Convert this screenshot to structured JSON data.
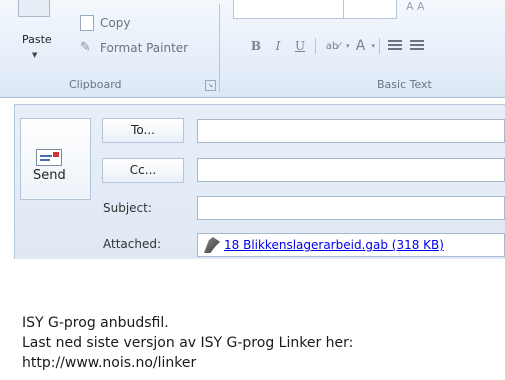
{
  "clipboard": {
    "paste_label": "Paste",
    "copy_label": "Copy",
    "format_painter_label": "Format Painter",
    "group_label": "Clipboard"
  },
  "basic_text": {
    "group_label": "Basic Text",
    "bold": "B",
    "italic": "I",
    "underline": "U",
    "highlight": "ab⁄",
    "font_color": "A"
  },
  "compose": {
    "send_label": "Send",
    "to_label": "To...",
    "cc_label": "Cc...",
    "subject_label": "Subject:",
    "attached_label": "Attached:",
    "to_value": "",
    "cc_value": "",
    "subject_value": "",
    "attachment": "18 Blikkenslagerarbeid.gab (318 KB)"
  },
  "message": {
    "lines": [
      "ISY G-prog anbudsfil.",
      "Last ned siste versjon av ISY G-prog Linker her:",
      "http://www.nois.no/linker"
    ]
  }
}
